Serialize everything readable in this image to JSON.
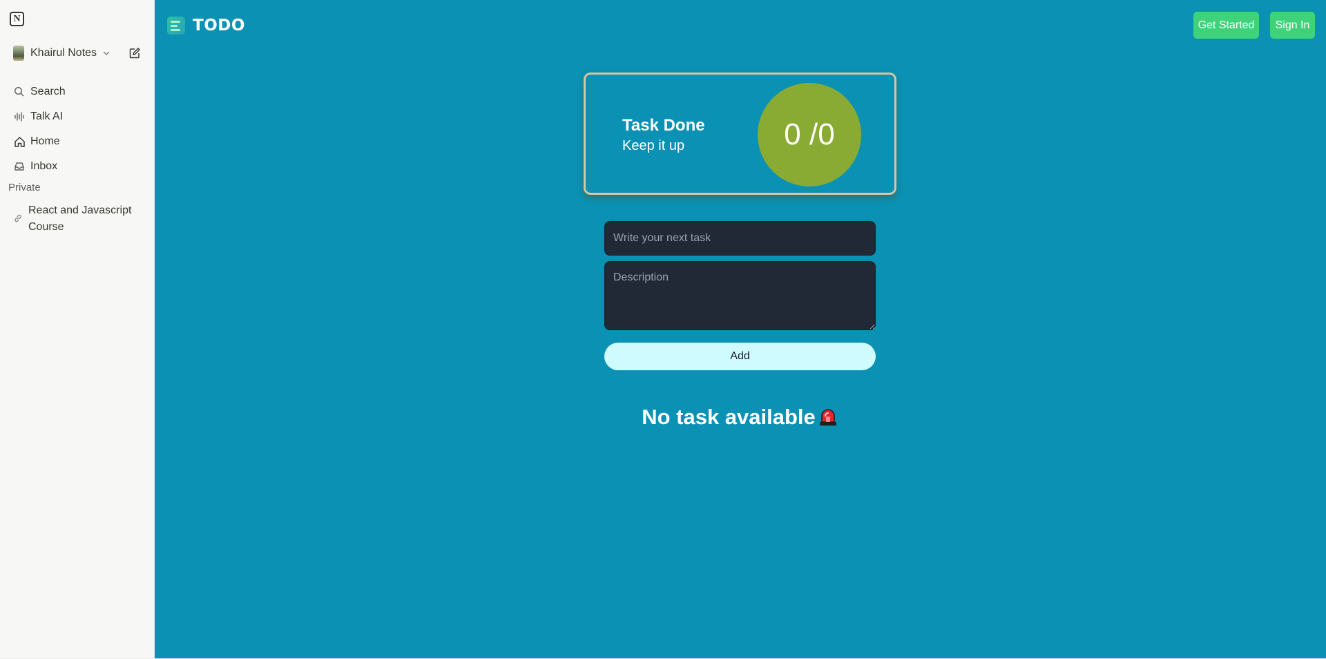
{
  "sidebar": {
    "workspace_name": "Khairul Notes",
    "nav": [
      {
        "label": "Search",
        "icon": "search-icon"
      },
      {
        "label": "Talk AI",
        "icon": "waveform-icon"
      },
      {
        "label": "Home",
        "icon": "home-icon"
      },
      {
        "label": "Inbox",
        "icon": "inbox-icon"
      }
    ],
    "section_label": "Private",
    "pages": [
      {
        "label": "React and Javascript Course",
        "icon": "link-icon"
      }
    ]
  },
  "header": {
    "brand": "TODO",
    "get_started": "Get Started",
    "sign_in": "Sign In"
  },
  "progress": {
    "title": "Task Done",
    "subtitle": "Keep it up",
    "counter": "0 /0",
    "done": 0,
    "total": 0
  },
  "form": {
    "task_placeholder": "Write your next task",
    "description_placeholder": "Description",
    "add_label": "Add"
  },
  "empty_state": {
    "message": "No task available",
    "icon": "siren-icon"
  },
  "colors": {
    "main_bg": "#0a91b4",
    "sidebar_bg": "#f7f7f5",
    "accent_green": "#3ed37a",
    "progress_circle": "#8aab33",
    "input_bg": "#212936",
    "add_button_bg": "#cffafe"
  }
}
